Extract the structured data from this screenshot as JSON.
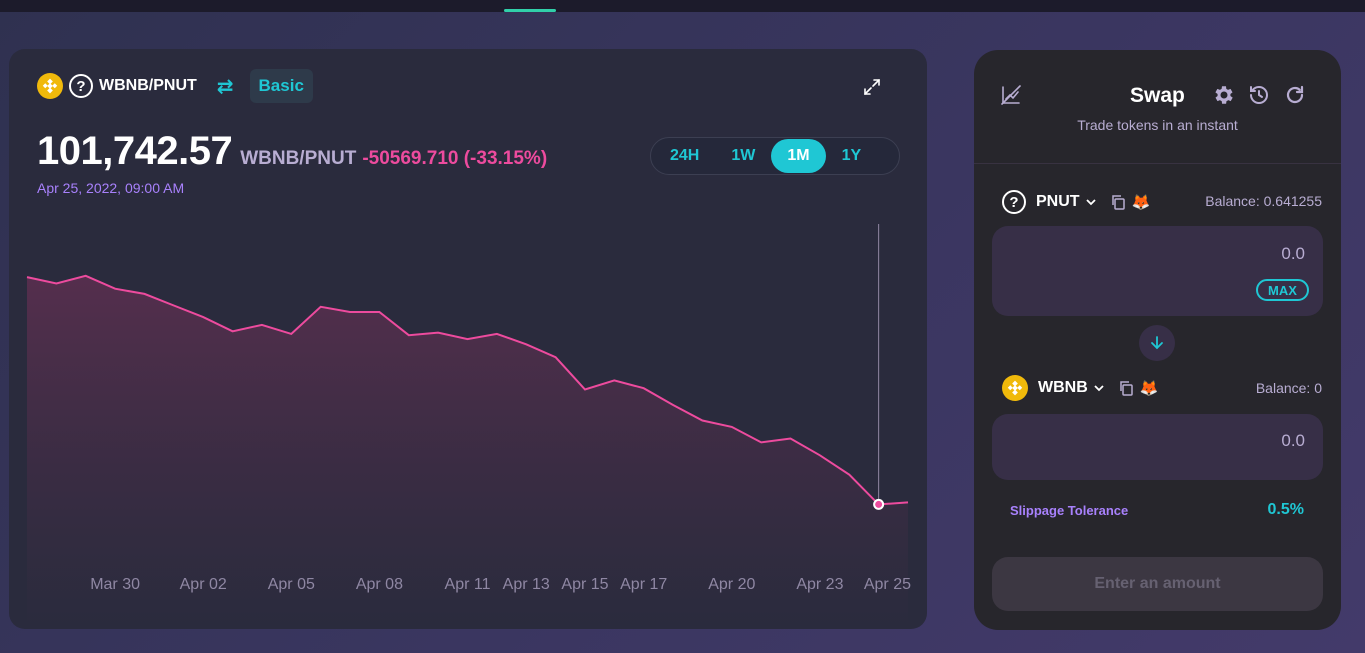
{
  "chart_header": {
    "pair": "WBNB/PNUT",
    "mode_label": "Basic",
    "price": "101,742.57",
    "price_pair": "WBNB/PNUT",
    "change": "-50569.710 (-33.15%)",
    "date": "Apr 25, 2022, 09:00 AM"
  },
  "ranges": [
    {
      "label": "24H",
      "active": false
    },
    {
      "label": "1W",
      "active": false
    },
    {
      "label": "1M",
      "active": true
    },
    {
      "label": "1Y",
      "active": false
    }
  ],
  "chart_data": {
    "type": "area",
    "title": "",
    "xlabel": "",
    "ylabel": "",
    "x_tick_labels": [
      "Mar 30",
      "Apr 02",
      "Apr 05",
      "Apr 08",
      "Apr 11",
      "Apr 13",
      "Apr 15",
      "Apr 17",
      "Apr 20",
      "Apr 23",
      "Apr 25"
    ],
    "series": [
      {
        "values": [
          153000,
          150500,
          153500,
          148500,
          146500,
          142000,
          137500,
          132000,
          134500,
          131000,
          141500,
          139500,
          139500,
          130500,
          131500,
          129000,
          131000,
          127000,
          122000,
          109500,
          113000,
          110000,
          103500,
          97500,
          95000,
          89000,
          90500,
          84000,
          76500,
          65000,
          65800
        ]
      }
    ],
    "hover_point": {
      "value": 101742.57,
      "date": "Apr 25, 2022, 09:00 AM"
    },
    "line_color": "#ed4b9e",
    "grid": false
  },
  "swap": {
    "title": "Swap",
    "subtitle": "Trade tokens in an instant",
    "from": {
      "symbol": "PNUT",
      "balance": "Balance: 0.641255",
      "amount": "0.0",
      "max_label": "MAX"
    },
    "to": {
      "symbol": "WBNB",
      "balance": "Balance: 0",
      "amount": "0.0"
    },
    "slippage_label": "Slippage Tolerance",
    "slippage_value": "0.5%",
    "submit_label": "Enter an amount"
  },
  "colors": {
    "accent": "#1fc7d4",
    "negative": "#ed4b9e",
    "secondary": "#a881fc"
  }
}
